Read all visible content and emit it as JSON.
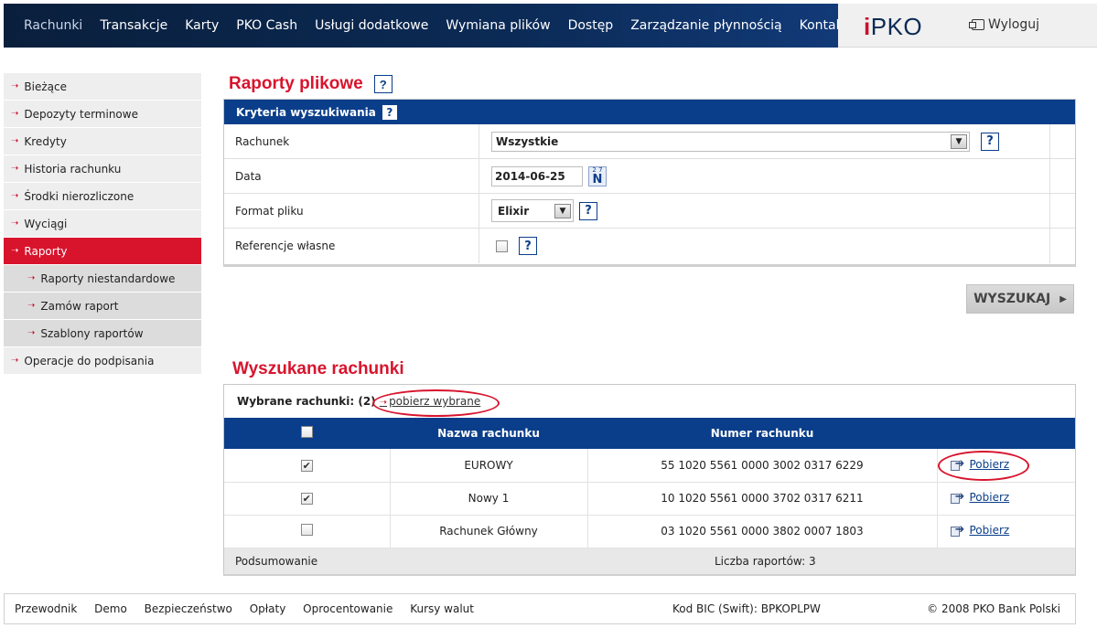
{
  "nav": {
    "items": [
      "Rachunki",
      "Transakcje",
      "Karty",
      "PKO Cash",
      "Usługi dodatkowe",
      "Wymiana plików",
      "Dostęp",
      "Zarządzanie płynnością",
      "Kontakt"
    ],
    "logo_i": "i",
    "logo_text": "PKO",
    "logout": "Wyloguj"
  },
  "sidebar": {
    "items": [
      {
        "label": "Bieżące"
      },
      {
        "label": "Depozyty terminowe"
      },
      {
        "label": "Kredyty"
      },
      {
        "label": "Historia rachunku"
      },
      {
        "label": "Środki nierozliczone"
      },
      {
        "label": "Wyciągi"
      },
      {
        "label": "Raporty"
      },
      {
        "label": "Raporty niestandardowe"
      },
      {
        "label": "Zamów raport"
      },
      {
        "label": "Szablony raportów"
      },
      {
        "label": "Operacje do podpisania"
      }
    ]
  },
  "page": {
    "title": "Raporty plikowe",
    "help": "?"
  },
  "criteria": {
    "header": "Kryteria wyszukiwania",
    "account_label": "Rachunek",
    "account_value": "Wszystkie",
    "date_label": "Data",
    "date_value": "2014-06-25",
    "cal_top": "2 7",
    "cal_letter": "N",
    "format_label": "Format pliku",
    "format_value": "Elixir",
    "ref_label": "Referencje własne"
  },
  "search_button": "WYSZUKAJ",
  "results": {
    "title": "Wyszukane rachunki",
    "selected_label": "Wybrane rachunki: (2)",
    "download_selected": "pobierz wybrane",
    "col_name": "Nazwa rachunku",
    "col_number": "Numer rachunku",
    "rows": [
      {
        "checked": true,
        "name": "EUROWY",
        "number": "55 1020 5561 0000 3002 0317 6229",
        "action": "Pobierz"
      },
      {
        "checked": true,
        "name": "Nowy 1",
        "number": "10 1020 5561 0000 3702 0317 6211",
        "action": "Pobierz"
      },
      {
        "checked": false,
        "name": "Rachunek Główny",
        "number": "03 1020 5561 0000 3802 0007 1803",
        "action": "Pobierz"
      }
    ],
    "summary_label": "Podsumowanie",
    "summary_count": "Liczba raportów: 3"
  },
  "footer": {
    "links": [
      "Przewodnik",
      "Demo",
      "Bezpieczeństwo",
      "Opłaty",
      "Oprocentowanie",
      "Kursy walut"
    ],
    "bic": "Kod BIC (Swift): BPKOPLPW",
    "copyright": "© 2008 PKO Bank Polski"
  },
  "colors": {
    "brand_navy": "#0b3e8a",
    "accent_red": "#d8142d"
  }
}
